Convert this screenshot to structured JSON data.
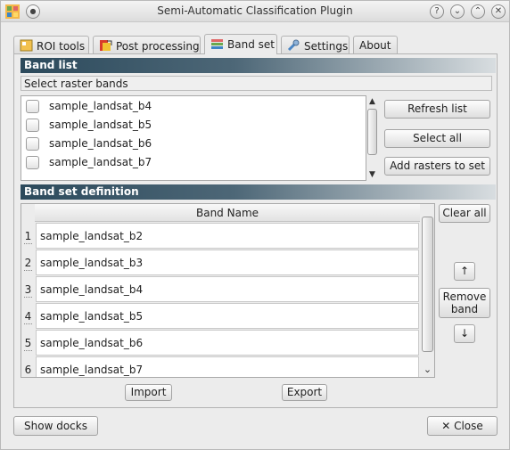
{
  "window": {
    "title": "Semi-Automatic Classification Plugin",
    "controls": [
      "?",
      "⌄",
      "⌃",
      "✕"
    ]
  },
  "tabs": [
    {
      "label": "ROI tools",
      "icon": "roi-tools-icon"
    },
    {
      "label": "Post processing",
      "icon": "post-processing-icon"
    },
    {
      "label": "Band set",
      "icon": "band-set-icon",
      "active": true
    },
    {
      "label": "Settings",
      "icon": "wrench-icon"
    },
    {
      "label": "About",
      "icon": ""
    }
  ],
  "band_list": {
    "header": "Band list",
    "sublabel": "Select raster bands",
    "items": [
      "sample_landsat_b4",
      "sample_landsat_b5",
      "sample_landsat_b6",
      "sample_landsat_b7"
    ],
    "buttons": {
      "refresh": "Refresh list",
      "select_all": "Select all",
      "add_rasters": "Add rasters to set"
    }
  },
  "band_set": {
    "header": "Band set definition",
    "column": "Band Name",
    "rows": [
      {
        "num": "1",
        "name": "sample_landsat_b2"
      },
      {
        "num": "2",
        "name": "sample_landsat_b3"
      },
      {
        "num": "3",
        "name": "sample_landsat_b4"
      },
      {
        "num": "4",
        "name": "sample_landsat_b5"
      },
      {
        "num": "5",
        "name": "sample_landsat_b6"
      },
      {
        "num": "6",
        "name": "sample_landsat_b7"
      }
    ],
    "buttons": {
      "clear_all": "Clear all",
      "move_up": "↑",
      "remove_band": "Remove band",
      "move_down": "↓",
      "import": "Import",
      "export": "Export"
    }
  },
  "footer": {
    "show_docks": "Show docks",
    "close": "✕  Close"
  },
  "colors": {
    "section_header": "#2c4a5c",
    "background": "#ececec"
  }
}
